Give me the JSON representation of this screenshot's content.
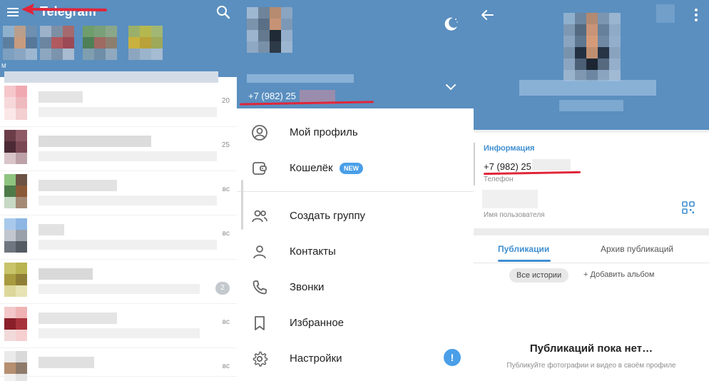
{
  "panel_chats": {
    "app_title": "Telegram",
    "story_label": "М",
    "chats": [
      {
        "time": "20",
        "badge": ""
      },
      {
        "time": "25",
        "badge": ""
      },
      {
        "time": "вс",
        "badge": ""
      },
      {
        "time": "вс",
        "badge": ""
      },
      {
        "time": "",
        "badge": "2"
      },
      {
        "time": "вс",
        "badge": ""
      },
      {
        "time": "вс",
        "badge": ""
      }
    ],
    "icons": {
      "menu": "menu-icon",
      "search": "search-icon"
    },
    "colors": {
      "header": "#5a8fc0",
      "arrow": "#e0263a"
    }
  },
  "panel_menu": {
    "phone": "+7 (982) 25",
    "items": [
      {
        "label": "Мой профиль",
        "icon": "profile-icon"
      },
      {
        "label": "Кошелёк",
        "icon": "wallet-icon",
        "badge": "NEW"
      },
      {
        "label": "Создать группу",
        "icon": "group-icon"
      },
      {
        "label": "Контакты",
        "icon": "contacts-icon"
      },
      {
        "label": "Звонки",
        "icon": "phone-icon"
      },
      {
        "label": "Избранное",
        "icon": "bookmark-icon"
      },
      {
        "label": "Настройки",
        "icon": "settings-icon",
        "alert": "!"
      }
    ]
  },
  "panel_profile": {
    "info_title": "Информация",
    "phone": "+7 (982) 25",
    "phone_label": "Телефон",
    "username_label": "Имя пользователя",
    "tabs": [
      "Публикации",
      "Архив публикаций"
    ],
    "chip": "Все истории",
    "add_album": "+ Добавить альбом",
    "empty_title": "Публикаций пока нет…",
    "empty_subtitle": "Публикуйте фотографии и видео в своём профиле"
  }
}
